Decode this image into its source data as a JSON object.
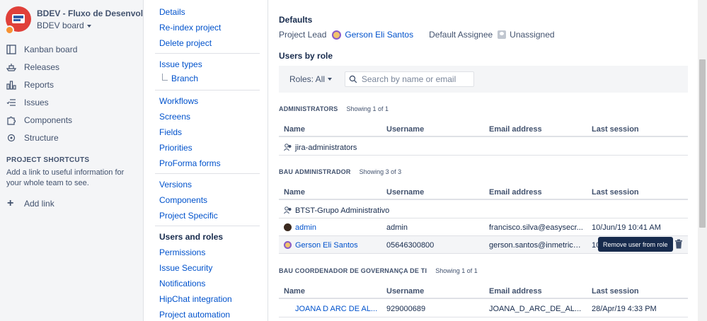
{
  "project": {
    "title": "BDEV - Fluxo de Desenvol...",
    "board": "BDEV board"
  },
  "sidebar": {
    "items": [
      {
        "label": "Kanban board",
        "icon": "kanban-icon"
      },
      {
        "label": "Releases",
        "icon": "ship-icon"
      },
      {
        "label": "Reports",
        "icon": "chart-icon"
      },
      {
        "label": "Issues",
        "icon": "issues-icon"
      },
      {
        "label": "Components",
        "icon": "puzzle-icon"
      },
      {
        "label": "Structure",
        "icon": "structure-icon"
      }
    ],
    "shortcuts_heading": "PROJECT SHORTCUTS",
    "shortcuts_desc": "Add a link to useful information for your whole team to see.",
    "add_link": "Add link"
  },
  "settings_nav": {
    "details": "Details",
    "reindex": "Re-index project",
    "delete": "Delete project",
    "issue_types": "Issue types",
    "branch": "Branch",
    "workflows": "Workflows",
    "screens": "Screens",
    "fields": "Fields",
    "priorities": "Priorities",
    "proforma": "ProForma forms",
    "versions": "Versions",
    "components": "Components",
    "project_specific": "Project Specific",
    "users_roles": "Users and roles",
    "permissions": "Permissions",
    "issue_security": "Issue Security",
    "notifications": "Notifications",
    "hipchat": "HipChat integration",
    "automation": "Project automation"
  },
  "main": {
    "defaults_heading": "Defaults",
    "project_lead_label": "Project Lead",
    "project_lead": "Gerson Eli Santos",
    "default_assignee_label": "Default Assignee",
    "default_assignee": "Unassigned",
    "users_by_role": "Users by role",
    "roles_filter": "Roles: All",
    "search_placeholder": "Search by name or email",
    "columns": {
      "name": "Name",
      "username": "Username",
      "email": "Email address",
      "last_session": "Last session"
    },
    "roles": [
      {
        "name": "ADMINISTRATORS",
        "count": "Showing 1 of 1",
        "rows": [
          {
            "name": "jira-administrators",
            "username": "",
            "email": "",
            "last_session": ""
          }
        ]
      },
      {
        "name": "BAU ADMINISTRADOR",
        "count": "Showing 3 of 3",
        "rows": [
          {
            "name": "BTST-Grupo Administrativo",
            "username": "",
            "email": "",
            "last_session": ""
          },
          {
            "name": "admin",
            "username": "admin",
            "email": "francisco.silva@easysecr...",
            "last_session": "10/Jun/19 10:41 AM"
          },
          {
            "name": "Gerson Eli Santos",
            "username": "05646300800",
            "email": "gerson.santos@inmetrics....",
            "last_session": "10"
          }
        ]
      },
      {
        "name": "BAU COORDENADOR DE GOVERNANÇA DE TI",
        "count": "Showing 1 of 1",
        "rows": [
          {
            "name": "JOANA D ARC DE AL...",
            "username": "929000689",
            "email": "JOANA_D_ARC_DE_AL...",
            "last_session": "28/Apr/19 4:33 PM"
          }
        ]
      }
    ],
    "tooltip": "Remove user from role"
  }
}
